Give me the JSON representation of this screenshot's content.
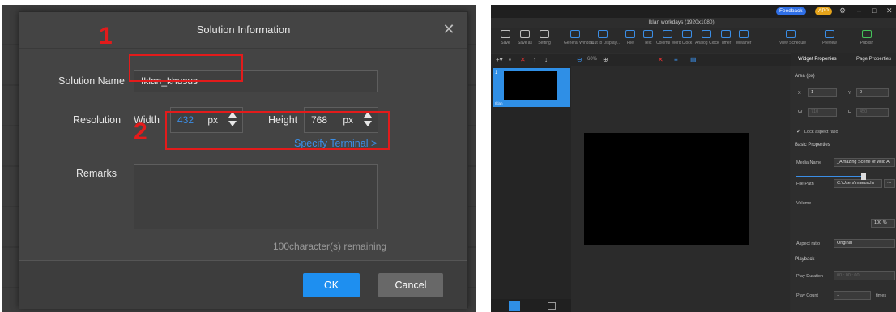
{
  "dialog": {
    "title": "Solution Information",
    "close_glyph": "✕",
    "solution_name_label": "Solution Name",
    "solution_name_value": "Iklan_khusus",
    "resolution_label": "Resolution",
    "width_label": "Width",
    "width_value": "432",
    "width_unit": "px",
    "height_label": "Height",
    "height_value": "768",
    "height_unit": "px",
    "specify_terminal": "Specify Terminal >",
    "remarks_label": "Remarks",
    "remarks_value": "",
    "remaining": "100character(s) remaining",
    "ok": "OK",
    "cancel": "Cancel",
    "annotation_1": "1",
    "annotation_2": "2",
    "colors": {
      "accent": "#1e8ff0",
      "annotation": "#e31b1b"
    }
  },
  "editor": {
    "feedback": "Feedback",
    "app": "APP",
    "title": "Iklan workdays (1920x1080)",
    "toolbar": [
      {
        "label": "Save",
        "icon": "save-icon"
      },
      {
        "label": "Save as",
        "icon": "save-as-icon"
      },
      {
        "label": "Setting",
        "icon": "gear-icon"
      },
      {
        "label": "General Window",
        "icon": "window-icon"
      },
      {
        "label": "Cut to Display...",
        "icon": "display-icon"
      },
      {
        "label": "File",
        "icon": "folder-icon"
      },
      {
        "label": "Text",
        "icon": "text-icon"
      },
      {
        "label": "Colorful Word",
        "icon": "colorful-word-icon"
      },
      {
        "label": "Clock",
        "icon": "clock-icon"
      },
      {
        "label": "Analog Clock",
        "icon": "analog-clock-icon"
      },
      {
        "label": "Timer",
        "icon": "timer-icon"
      },
      {
        "label": "Weather",
        "icon": "weather-icon"
      },
      {
        "label": "View Schedule",
        "icon": "calendar-icon"
      },
      {
        "label": "Preview",
        "icon": "eye-icon"
      },
      {
        "label": "Publish",
        "icon": "send-icon"
      }
    ],
    "zoom": "60%",
    "page_name": "Iklan",
    "page_number": "1",
    "props": {
      "tab_widget": "Widget Properties",
      "tab_page": "Page Properties",
      "area_section": "Area (px)",
      "x_label": "X",
      "x_value": "1",
      "y_label": "Y",
      "y_value": "0",
      "w_label": "W",
      "w_value": "710",
      "h_label": "H",
      "h_value": "450",
      "lock_aspect": "Lock aspect ratio",
      "basic_section": "Basic Properties",
      "media_name_label": "Media Name",
      "media_name_value": "_Amazing Scene of Wild A",
      "file_path_label": "File Path",
      "file_path_value": "C:\\Users\\maeurch\\",
      "file_path_button": "···",
      "volume_label": "Volume",
      "volume_value": "100 %",
      "aspect_label": "Aspect ratio",
      "aspect_value": "Original",
      "playback_section": "Playback",
      "play_duration_label": "Play Duration",
      "play_duration_value": "00 : 00 : 00",
      "play_count_label": "Play Count",
      "play_count_value": "1",
      "play_count_unit": "times"
    }
  }
}
